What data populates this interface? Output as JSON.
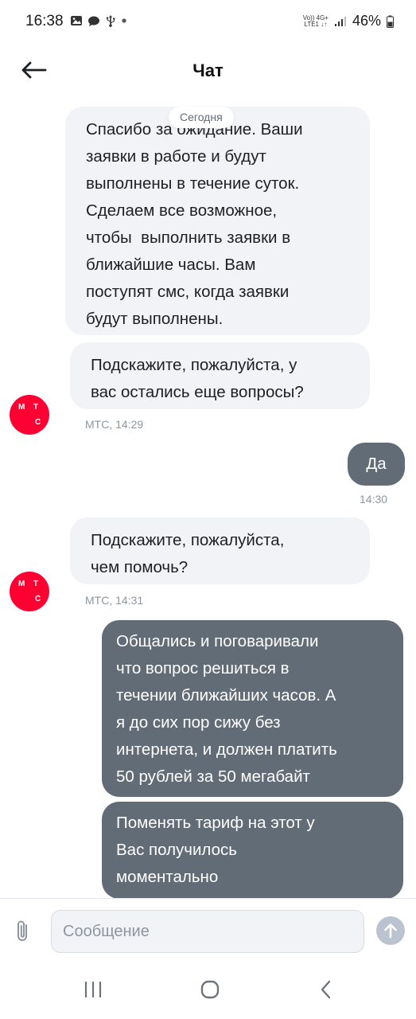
{
  "status_bar": {
    "time": "16:38",
    "network_top": "Vo)) 4G+",
    "network_bottom": "LTE1 ↓↑",
    "battery": "46%"
  },
  "header": {
    "title": "Чат",
    "back_icon": "arrow-left-icon"
  },
  "chat": {
    "date_separator": "Сегодня",
    "messages": [
      {
        "direction": "incoming",
        "lines": [
          "Спасибо за ожидание. Ваши",
          "заявки в работе и будут",
          "выполнены в течение суток.",
          "Сделаем все возможное,",
          "чтобы  выполнить заявки в",
          "ближайшие часы. Вам",
          "поступят смс, когда заявки",
          "будут выполнены."
        ]
      },
      {
        "direction": "incoming",
        "lines": [
          "Подскажите, пожалуйста, у",
          "вас остались еще вопросы?"
        ],
        "meta": "МТС, 14:29",
        "avatar_letters": [
          "М",
          "Т",
          "С"
        ]
      },
      {
        "direction": "outgoing",
        "lines": [
          "Да"
        ],
        "meta": "14:30"
      },
      {
        "direction": "incoming",
        "lines": [
          "Подскажите, пожалуйста,",
          "чем помочь?"
        ],
        "meta": "МТС, 14:31",
        "avatar_letters": [
          "М",
          "Т",
          "С"
        ]
      },
      {
        "direction": "outgoing",
        "lines": [
          "Общались и поговаривали",
          "что вопрос решиться в",
          "течении ближайших часов. А",
          "я до сих пор сижу без",
          "интернета, и должен платить",
          "50 рублей за 50 мегабайт"
        ]
      },
      {
        "direction": "outgoing",
        "lines": [
          "Поменять тариф на этот у",
          "Вас получилось",
          "моментально"
        ]
      }
    ]
  },
  "composer": {
    "placeholder": "Сообщение",
    "value": "",
    "attach_icon": "paperclip-icon",
    "send_icon": "arrow-up-icon"
  },
  "colors": {
    "incoming_bubble": "#f2f3f7",
    "outgoing_bubble": "#626c77",
    "brand_red": "#ff0032",
    "meta_text": "#8d969f"
  }
}
